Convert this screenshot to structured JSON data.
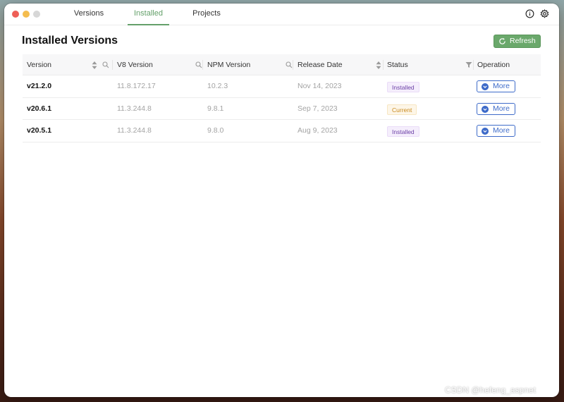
{
  "tabs": [
    {
      "label": "Versions"
    },
    {
      "label": "Installed"
    },
    {
      "label": "Projects"
    }
  ],
  "active_tab": "Installed",
  "page": {
    "title": "Installed Versions"
  },
  "toolbar": {
    "refresh_label": "Refresh"
  },
  "table": {
    "columns": [
      "Version",
      "V8 Version",
      "NPM Version",
      "Release Date",
      "Status",
      "Operation"
    ],
    "rows": [
      {
        "version": "v21.2.0",
        "v8": "11.8.172.17",
        "npm": "10.2.3",
        "date": "Nov 14, 2023",
        "status": "Installed",
        "operation": "More"
      },
      {
        "version": "v20.6.1",
        "v8": "11.3.244.8",
        "npm": "9.8.1",
        "date": "Sep 7, 2023",
        "status": "Current",
        "operation": "More"
      },
      {
        "version": "v20.5.1",
        "v8": "11.3.244.8",
        "npm": "9.8.0",
        "date": "Aug 9, 2023",
        "status": "Installed",
        "operation": "More"
      }
    ]
  },
  "watermark": "CSDN @hefeng_aspnet",
  "colors": {
    "accent": "#64a06a",
    "link": "#3e6bc9",
    "installed_badge": "#6b3fa6",
    "current_badge": "#c98a1e"
  },
  "icons": {
    "info": "info-icon",
    "settings": "gear-icon",
    "refresh": "refresh-icon",
    "sort": "sort-icon",
    "search": "search-icon",
    "filter": "filter-icon",
    "more": "chevron-down-icon"
  }
}
